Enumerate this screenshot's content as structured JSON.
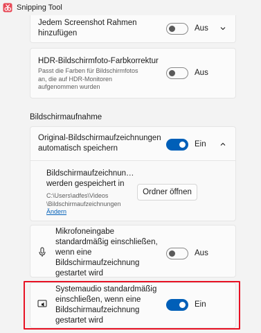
{
  "app": {
    "title": "Snipping Tool"
  },
  "settings": {
    "frame": {
      "label_line1": "Jedem Screenshot Rahmen",
      "label_line2": "hinzufügen",
      "toggle_text": "Aus"
    },
    "hdr": {
      "label": "HDR-Bildschirmfoto-Farbkorrektur",
      "desc_line1": "Passt die Farben für Bildschirmfotos",
      "desc_line2": "an, die auf HDR-Monitoren",
      "desc_line3": "aufgenommen wurden",
      "toggle_text": "Aus"
    }
  },
  "recording": {
    "heading": "Bildschirmaufnahme",
    "autosave": {
      "label_line1": "Original-Bildschirmaufzeichnungen",
      "label_line2": "automatisch speichern",
      "toggle_text": "Ein"
    },
    "location": {
      "label_line1": "Bildschirmaufzeichnun…",
      "label_line2": "werden gespeichert in",
      "path_line1": "C:\\Users\\adfes\\Videos",
      "path_line2": "\\Bildschirmaufzeichnungen",
      "change_link": "Ändern",
      "open_folder_button": "Ordner öffnen"
    },
    "mic": {
      "label_line1": "Mikrofoneingabe",
      "label_line2": "standardmäßig einschließen,",
      "label_line3": "wenn eine",
      "label_line4": "Bildschirmaufzeichnung",
      "label_line5": "gestartet wird",
      "toggle_text": "Aus"
    },
    "system_audio": {
      "label_line1": "Systemaudio standardmäßig",
      "label_line2": "einschließen, wenn eine",
      "label_line3": "Bildschirmaufzeichnung",
      "label_line4": "gestartet wird",
      "toggle_text": "Ein"
    }
  },
  "colors": {
    "accent": "#005fb8",
    "highlight": "#e81123"
  }
}
